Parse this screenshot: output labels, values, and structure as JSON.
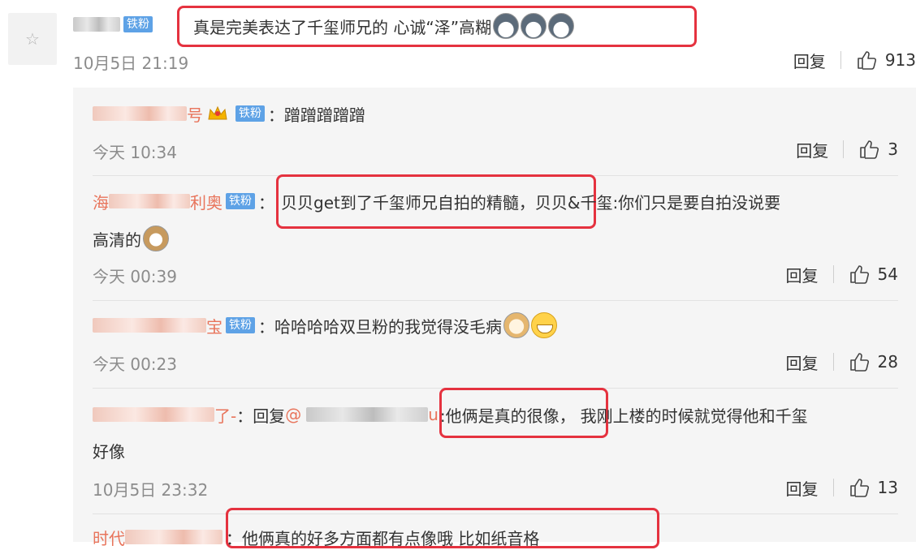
{
  "main_comment": {
    "badge": "铁粉",
    "text": "真是完美表达了千玺师兄的 心诚“泽”高糊",
    "time": "10月5日 21:19",
    "reply_label": "回复",
    "likes": "913"
  },
  "replies": [
    {
      "name_suffix": "号",
      "badge": "铁粉",
      "colon": "：",
      "text": "蹭蹭蹭蹭蹭",
      "time": "今天 10:34",
      "reply_label": "回复",
      "likes": "3"
    },
    {
      "name_prefix": "海",
      "name_suffix": "利奥",
      "badge": "铁粉",
      "colon": "：",
      "text_highlight": "贝贝get到了千玺师兄自拍的精髓，",
      "text_rest": "贝贝&千玺:你们只是要自拍没说要",
      "text_line2": "高清的",
      "time": "今天 00:39",
      "reply_label": "回复",
      "likes": "54"
    },
    {
      "name_suffix": "宝",
      "badge": "铁粉",
      "colon": "：",
      "text": "哈哈哈哈双旦粉的我觉得没毛病",
      "time": "今天 00:23",
      "reply_label": "回复",
      "likes": "28"
    },
    {
      "name_suffix": "了-",
      "reply_prefix": "：回复",
      "mention_symbol": "@",
      "mention_suffix": "u",
      "text_highlight": ":他俩是真的很像，",
      "text_rest": "我刚上楼的时候就觉得他和千玺",
      "text_line2": "好像",
      "time": "10月5日 23:32",
      "reply_label": "回复",
      "likes": "13"
    },
    {
      "name_prefix": "时代",
      "text_highlight": "：他俩真的好多方面都有点像哦 比如纸音格"
    }
  ],
  "icons": {
    "avatar": "avatar-placeholder-icon",
    "like": "thumbs-up-icon",
    "crown": "crown-vip-icon"
  },
  "colors": {
    "badge": "#5ea2e6",
    "highlight": "#e5323f",
    "username_red": "#e8745b",
    "panel_bg": "#f5f5f5"
  }
}
